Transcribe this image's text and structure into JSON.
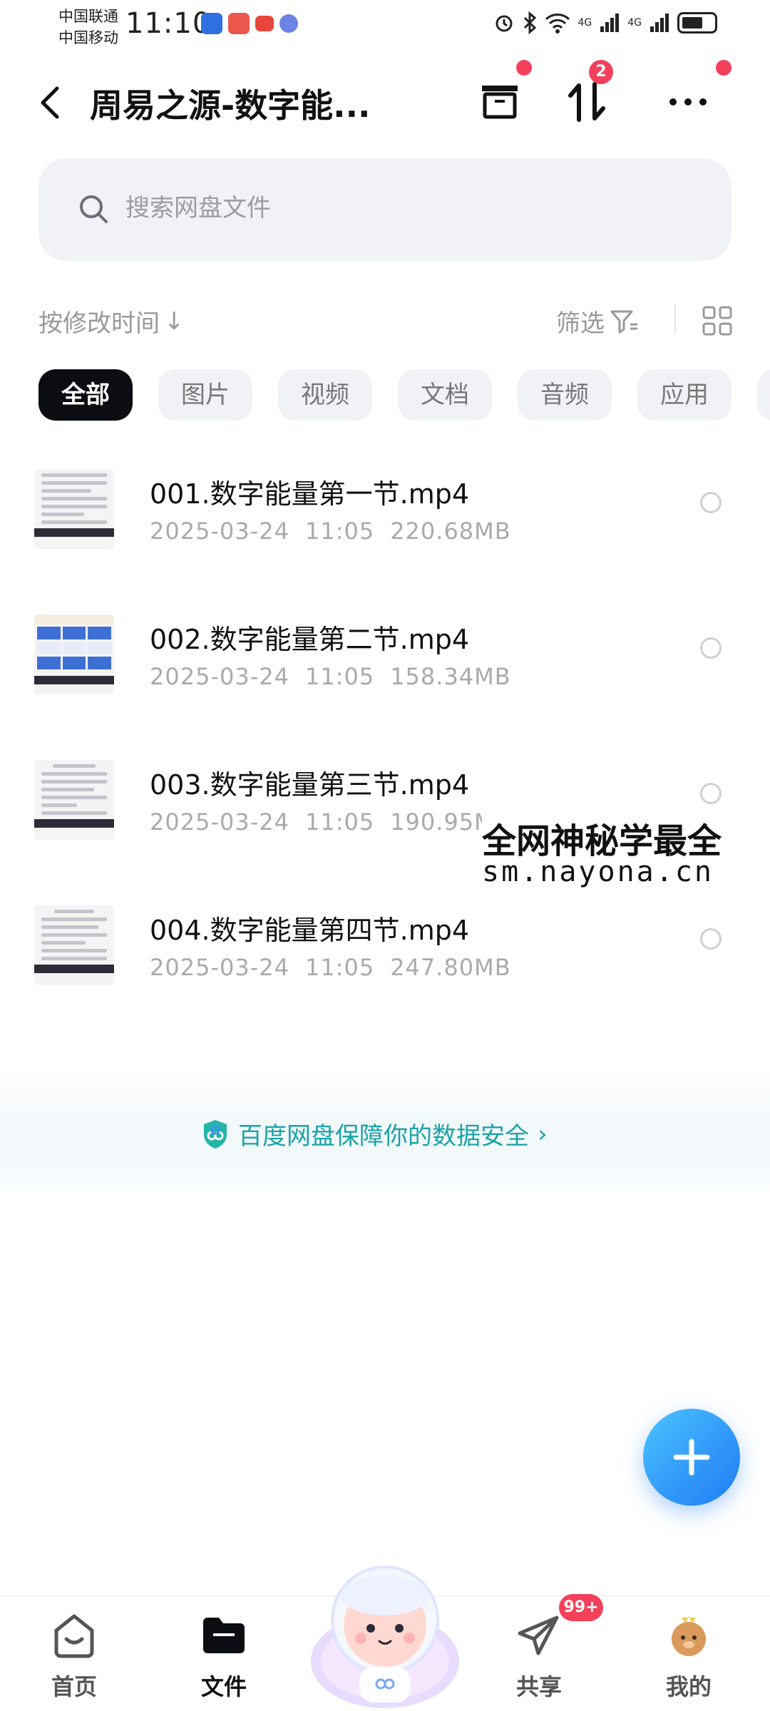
{
  "status_bar": {
    "carrier_1": "中国联通",
    "carrier_2": "中国移动",
    "time": "11:10",
    "signal_1_label": "4G",
    "signal_2_label": "4G"
  },
  "header": {
    "title": "周易之源-数字能...",
    "sort_badge_count": "2"
  },
  "search": {
    "placeholder": "搜索网盘文件"
  },
  "toolbar": {
    "sort_label": "按修改时间",
    "sort_arrow": "↓",
    "filter_label": "筛选"
  },
  "chips": [
    "全部",
    "图片",
    "视频",
    "文档",
    "音频",
    "应用"
  ],
  "files": [
    {
      "name": "001.数字能量第一节.mp4",
      "date": "2025-03-24",
      "time": "11:05",
      "size": "220.68MB"
    },
    {
      "name": "002.数字能量第二节.mp4",
      "date": "2025-03-24",
      "time": "11:05",
      "size": "158.34MB"
    },
    {
      "name": "003.数字能量第三节.mp4",
      "date": "2025-03-24",
      "time": "11:05",
      "size": "190.95M"
    },
    {
      "name": "004.数字能量第四节.mp4",
      "date": "2025-03-24",
      "time": "11:05",
      "size": "247.80MB"
    }
  ],
  "watermark": {
    "line1": "全网神秘学最全",
    "line2": "sm.nayona.cn"
  },
  "security_banner": {
    "text": "百度网盘保障你的数据安全",
    "chevron": "›"
  },
  "bottom_nav": {
    "home": "首页",
    "files": "文件",
    "share": "共享",
    "mine": "我的",
    "share_badge": "99+"
  },
  "colors": {
    "accent": "#1e7bf5",
    "badge_red": "#f4405a",
    "security_teal": "#1aa3a8",
    "chip_active": "#0c0d12"
  }
}
